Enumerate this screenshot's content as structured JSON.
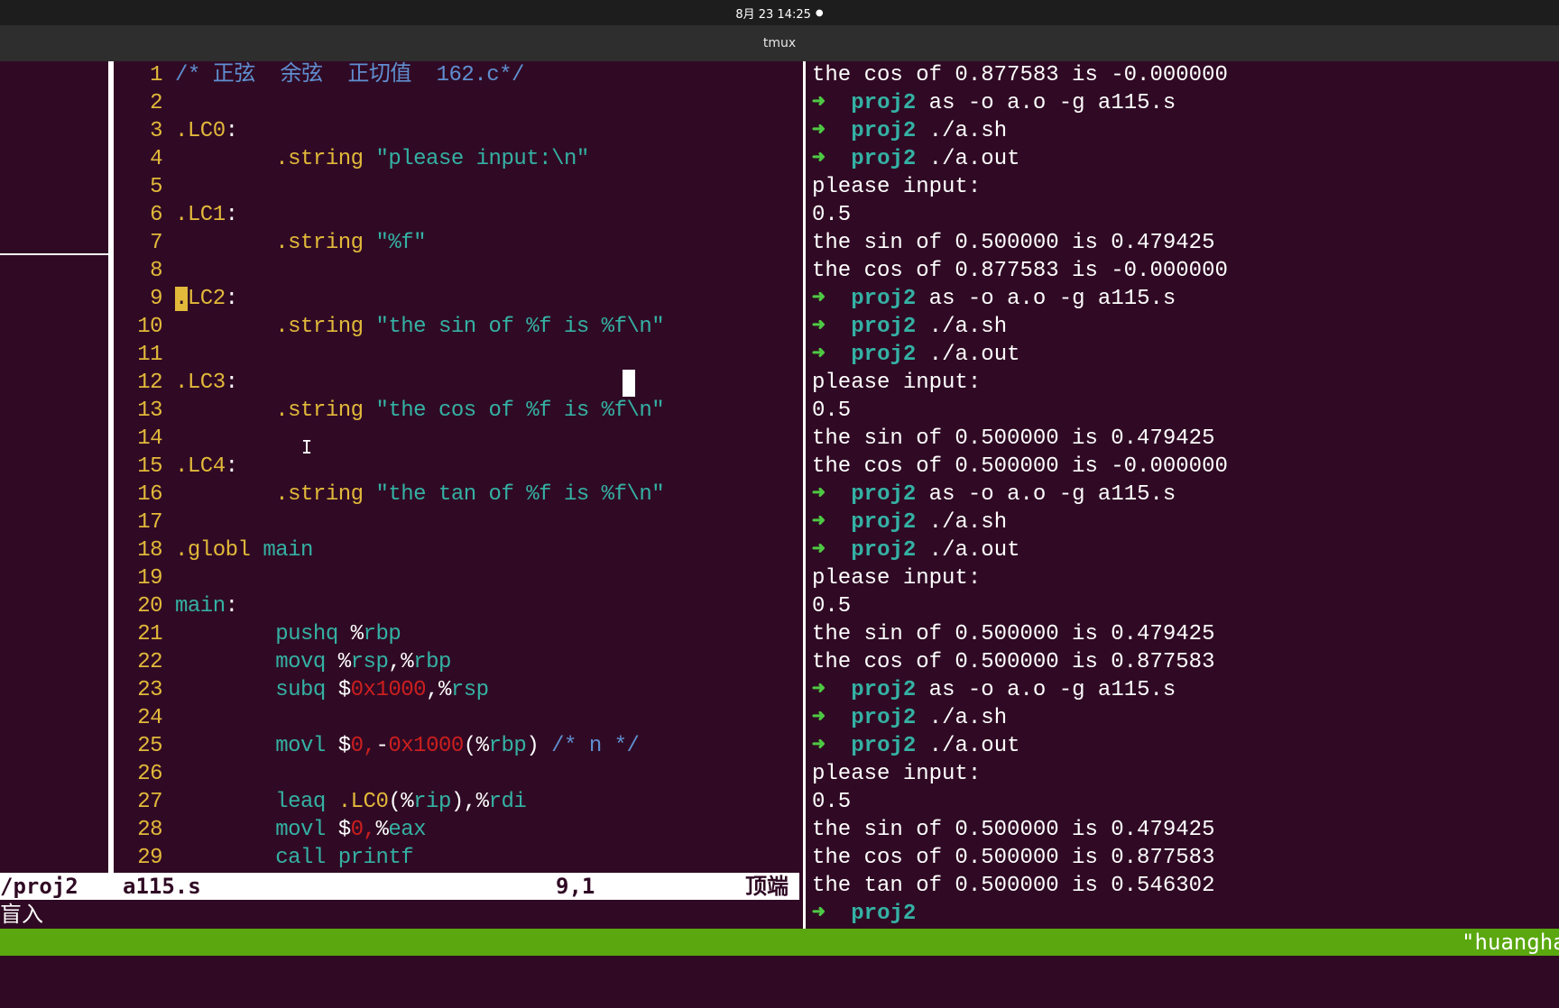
{
  "topbar": {
    "datetime": "8月 23  14:25",
    "dot": "●"
  },
  "window": {
    "title": "tmux"
  },
  "editor": {
    "lines": [
      {
        "n": "1",
        "parts": [
          {
            "t": "/* 正弦  余弦  正切值  162.c*/",
            "c": "c-comment"
          }
        ]
      },
      {
        "n": "2",
        "parts": []
      },
      {
        "n": "3",
        "parts": [
          {
            "t": ".LC0",
            "c": "c-label"
          },
          {
            "t": ":",
            "c": ""
          }
        ]
      },
      {
        "n": "4",
        "parts": [
          {
            "t": "        .string ",
            "c": "c-kw"
          },
          {
            "t": "\"please input:\\n\"",
            "c": "c-str"
          }
        ]
      },
      {
        "n": "5",
        "parts": []
      },
      {
        "n": "6",
        "parts": [
          {
            "t": ".LC1",
            "c": "c-label"
          },
          {
            "t": ":",
            "c": ""
          }
        ]
      },
      {
        "n": "7",
        "parts": [
          {
            "t": "        .string ",
            "c": "c-kw"
          },
          {
            "t": "\"%f\"",
            "c": "c-str"
          }
        ]
      },
      {
        "n": "8",
        "parts": []
      },
      {
        "n": "9",
        "parts": [
          {
            "t": ".",
            "c": "c-cursor"
          },
          {
            "t": "LC2",
            "c": "c-label"
          },
          {
            "t": ":",
            "c": ""
          }
        ]
      },
      {
        "n": "10",
        "parts": [
          {
            "t": "        .string ",
            "c": "c-kw"
          },
          {
            "t": "\"the sin of %f is %f\\n\"",
            "c": "c-str"
          }
        ]
      },
      {
        "n": "11",
        "parts": []
      },
      {
        "n": "12",
        "parts": [
          {
            "t": ".LC3",
            "c": "c-label"
          },
          {
            "t": ":",
            "c": ""
          }
        ]
      },
      {
        "n": "13",
        "parts": [
          {
            "t": "        .string ",
            "c": "c-kw"
          },
          {
            "t": "\"the cos of %f is %f\\n\"",
            "c": "c-str"
          }
        ]
      },
      {
        "n": "14",
        "parts": []
      },
      {
        "n": "15",
        "parts": [
          {
            "t": ".LC4",
            "c": "c-label"
          },
          {
            "t": ":",
            "c": ""
          }
        ]
      },
      {
        "n": "16",
        "parts": [
          {
            "t": "        .string ",
            "c": "c-kw"
          },
          {
            "t": "\"the tan of %f is %f\\n\"",
            "c": "c-str"
          }
        ]
      },
      {
        "n": "17",
        "parts": []
      },
      {
        "n": "18",
        "parts": [
          {
            "t": ".globl ",
            "c": "c-kw"
          },
          {
            "t": "main",
            "c": "c-reg"
          }
        ]
      },
      {
        "n": "19",
        "parts": []
      },
      {
        "n": "20",
        "parts": [
          {
            "t": "main",
            "c": "c-reg"
          },
          {
            "t": ":",
            "c": ""
          }
        ]
      },
      {
        "n": "21",
        "parts": [
          {
            "t": "        pushq ",
            "c": "c-reg"
          },
          {
            "t": "%",
            "c": ""
          },
          {
            "t": "rbp",
            "c": "c-reg"
          }
        ]
      },
      {
        "n": "22",
        "parts": [
          {
            "t": "        movq ",
            "c": "c-reg"
          },
          {
            "t": "%",
            "c": ""
          },
          {
            "t": "rsp",
            "c": "c-reg"
          },
          {
            "t": ",%",
            "c": ""
          },
          {
            "t": "rbp",
            "c": "c-reg"
          }
        ]
      },
      {
        "n": "23",
        "parts": [
          {
            "t": "        subq ",
            "c": "c-reg"
          },
          {
            "t": "$",
            "c": ""
          },
          {
            "t": "0x1000",
            "c": "c-num"
          },
          {
            "t": ",%",
            "c": ""
          },
          {
            "t": "rsp",
            "c": "c-reg"
          }
        ]
      },
      {
        "n": "24",
        "parts": []
      },
      {
        "n": "25",
        "parts": [
          {
            "t": "        movl ",
            "c": "c-reg"
          },
          {
            "t": "$",
            "c": ""
          },
          {
            "t": "0,",
            "c": "c-num"
          },
          {
            "t": "-",
            "c": ""
          },
          {
            "t": "0x1000",
            "c": "c-num"
          },
          {
            "t": "(%",
            "c": ""
          },
          {
            "t": "rbp",
            "c": "c-reg"
          },
          {
            "t": ") ",
            "c": ""
          },
          {
            "t": "/* n */",
            "c": "c-comment"
          }
        ]
      },
      {
        "n": "26",
        "parts": []
      },
      {
        "n": "27",
        "parts": [
          {
            "t": "        leaq ",
            "c": "c-reg"
          },
          {
            "t": ".LC0",
            "c": "c-label"
          },
          {
            "t": "(%",
            "c": ""
          },
          {
            "t": "rip",
            "c": "c-reg"
          },
          {
            "t": "),%",
            "c": ""
          },
          {
            "t": "rdi",
            "c": "c-reg"
          }
        ]
      },
      {
        "n": "28",
        "parts": [
          {
            "t": "        movl ",
            "c": "c-reg"
          },
          {
            "t": "$",
            "c": ""
          },
          {
            "t": "0,",
            "c": "c-num"
          },
          {
            "t": "%",
            "c": ""
          },
          {
            "t": "eax",
            "c": "c-reg"
          }
        ]
      },
      {
        "n": "29",
        "parts": [
          {
            "t": "        call ",
            "c": "c-reg"
          },
          {
            "t": "printf",
            "c": "c-reg"
          }
        ]
      }
    ]
  },
  "statusline": {
    "path": "/proj2",
    "file": "a115.s",
    "pos": "9,1",
    "scroll": "顶端"
  },
  "cmdline": {
    "text": "盲入"
  },
  "terminal": {
    "lines": [
      {
        "type": "out",
        "text": "the cos of 0.877583 is -0.000000"
      },
      {
        "type": "prompt",
        "dir": "proj2",
        "cmd": " as -o a.o -g a115.s"
      },
      {
        "type": "prompt",
        "dir": "proj2",
        "cmd": " ./a.sh"
      },
      {
        "type": "prompt",
        "dir": "proj2",
        "cmd": " ./a.out"
      },
      {
        "type": "out",
        "text": "please input:"
      },
      {
        "type": "out",
        "text": "0.5"
      },
      {
        "type": "out",
        "text": "the sin of 0.500000 is 0.479425"
      },
      {
        "type": "out",
        "text": "the cos of 0.877583 is -0.000000"
      },
      {
        "type": "prompt",
        "dir": "proj2",
        "cmd": " as -o a.o -g a115.s"
      },
      {
        "type": "prompt",
        "dir": "proj2",
        "cmd": " ./a.sh"
      },
      {
        "type": "prompt",
        "dir": "proj2",
        "cmd": " ./a.out"
      },
      {
        "type": "out",
        "text": "please input:"
      },
      {
        "type": "out",
        "text": "0.5"
      },
      {
        "type": "out",
        "text": "the sin of 0.500000 is 0.479425"
      },
      {
        "type": "out",
        "text": "the cos of 0.500000 is -0.000000"
      },
      {
        "type": "prompt",
        "dir": "proj2",
        "cmd": " as -o a.o -g a115.s"
      },
      {
        "type": "prompt",
        "dir": "proj2",
        "cmd": " ./a.sh"
      },
      {
        "type": "prompt",
        "dir": "proj2",
        "cmd": " ./a.out"
      },
      {
        "type": "out",
        "text": "please input:"
      },
      {
        "type": "out",
        "text": "0.5"
      },
      {
        "type": "out",
        "text": "the sin of 0.500000 is 0.479425"
      },
      {
        "type": "out",
        "text": "the cos of 0.500000 is 0.877583"
      },
      {
        "type": "prompt",
        "dir": "proj2",
        "cmd": " as -o a.o -g a115.s"
      },
      {
        "type": "prompt",
        "dir": "proj2",
        "cmd": " ./a.sh"
      },
      {
        "type": "prompt",
        "dir": "proj2",
        "cmd": " ./a.out"
      },
      {
        "type": "out",
        "text": "please input:"
      },
      {
        "type": "out",
        "text": "0.5"
      },
      {
        "type": "out",
        "text": "the sin of 0.500000 is 0.479425"
      },
      {
        "type": "out",
        "text": "the cos of 0.500000 is 0.877583"
      },
      {
        "type": "out",
        "text": "the tan of 0.500000 is 0.546302"
      },
      {
        "type": "prompt",
        "dir": "proj2",
        "cmd": ""
      }
    ],
    "prompt_arrow": "➜"
  },
  "tmux_status": {
    "right": "\"huangha"
  },
  "colors": {
    "bg": "#300a24",
    "green_bar": "#5aa70f",
    "prompt_arrow": "#4ec943",
    "dir": "#34b1a4",
    "line_number": "#e2b93a"
  },
  "icons": {
    "text_cursor": "i-beam-icon"
  }
}
